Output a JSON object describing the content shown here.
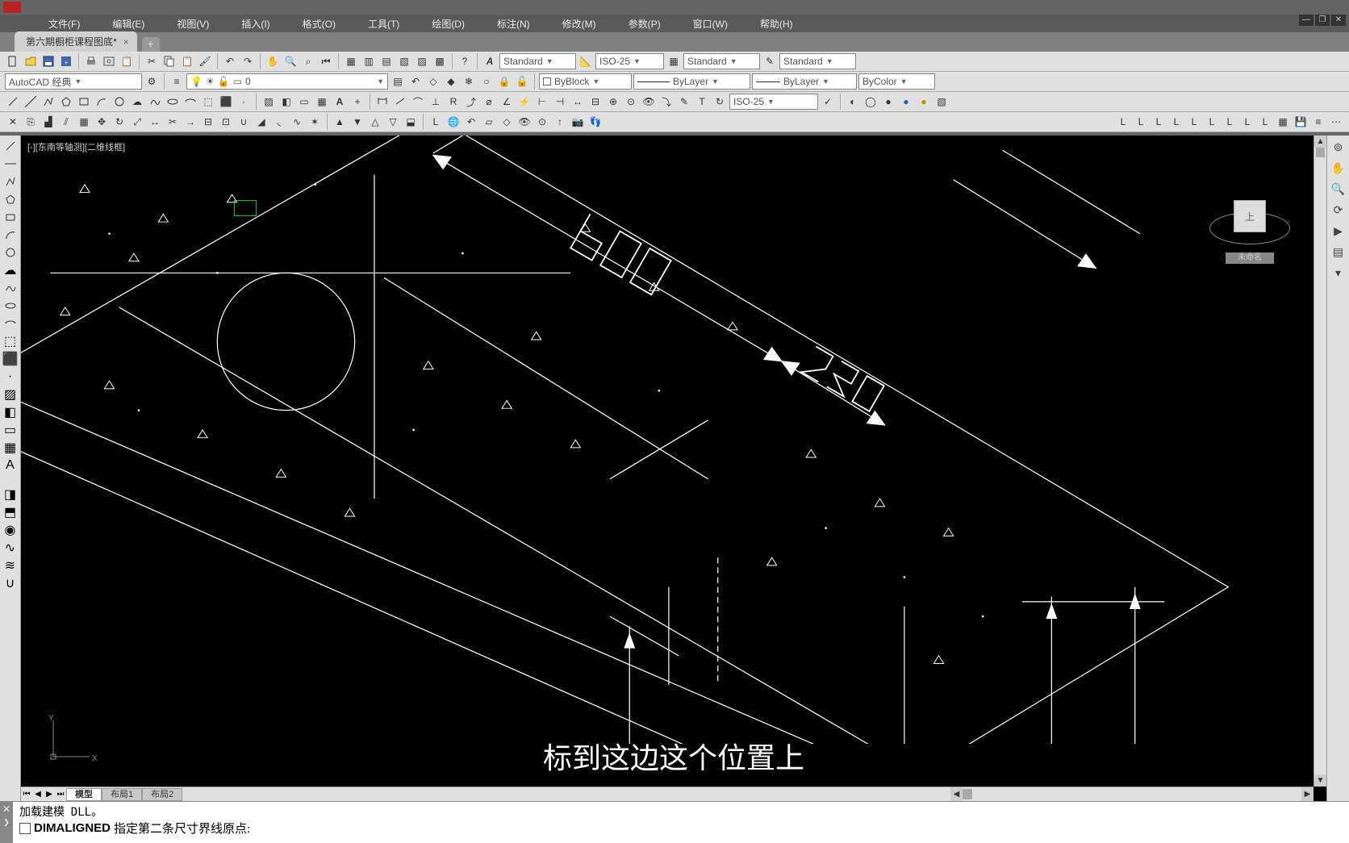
{
  "menubar": {
    "items": [
      "文件(F)",
      "编辑(E)",
      "视图(V)",
      "插入(I)",
      "格式(O)",
      "工具(T)",
      "绘图(D)",
      "标注(N)",
      "修改(M)",
      "参数(P)",
      "窗口(W)",
      "帮助(H)"
    ]
  },
  "tab": {
    "name": "第六期橱柜课程图底*",
    "close": "×",
    "add": "+"
  },
  "workspace_selector": "AutoCAD 经典",
  "styles": {
    "text_style": "Standard",
    "dim_style": "ISO-25",
    "table_style": "Standard",
    "mleader_style": "Standard",
    "dim_style_2": "ISO-25"
  },
  "props": {
    "color": "ByBlock",
    "linetype": "ByLayer",
    "lineweight": "ByLayer",
    "plotstyle": "ByColor"
  },
  "layer_selected": "0",
  "viewport_label": "[-][东南等轴测][二维线框]",
  "navcube": {
    "face": "上",
    "unnamed": "未命名"
  },
  "model_tabs": {
    "model": "模型",
    "layout1": "布局1",
    "layout2": "布局2"
  },
  "subtitle": "标到这边这个位置上",
  "command": {
    "line1_prefix": "加载建模",
    "line1_suffix": "DLL。",
    "line2_cmd": "DIMALIGNED",
    "line2_rest": "指定第二条尺寸界线原点:"
  },
  "icons": {
    "search": "🔍",
    "gear": "⚙",
    "layers": "▤"
  }
}
